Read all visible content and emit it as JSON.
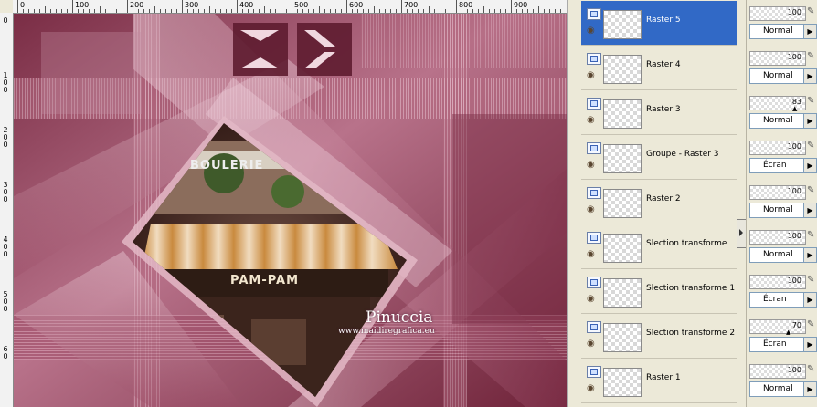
{
  "ruler": {
    "top_labels": [
      "0",
      "100",
      "200",
      "300",
      "400",
      "500",
      "600",
      "700",
      "800",
      "900"
    ],
    "left_labels": [
      "0",
      "1 0 0",
      "2 0 0",
      "3 0 0",
      "4 0 0",
      "5 0 0",
      "6 0"
    ]
  },
  "canvas": {
    "watermark_name": "Pinuccia",
    "watermark_url": "www.maidiregrafica.eu",
    "shop_sign": "PAM-PAM",
    "shop_sign_top": "BOULERIE"
  },
  "layers": [
    {
      "name": "Raster 5",
      "selected": true,
      "opacity": "100",
      "blend": "Normal"
    },
    {
      "name": "Raster 4",
      "selected": false,
      "opacity": "100",
      "blend": "Normal"
    },
    {
      "name": "Raster 3",
      "selected": false,
      "opacity": "83",
      "blend": "Normal"
    },
    {
      "name": "Groupe - Raster 3",
      "selected": false,
      "opacity": "100",
      "blend": "Écran"
    },
    {
      "name": "Raster 2",
      "selected": false,
      "opacity": "100",
      "blend": "Normal"
    },
    {
      "name": "Slection transforme",
      "selected": false,
      "opacity": "100",
      "blend": "Normal"
    },
    {
      "name": "Slection transforme 1",
      "selected": false,
      "opacity": "100",
      "blend": "Écran"
    },
    {
      "name": "Slection transforme 2",
      "selected": false,
      "opacity": "70",
      "blend": "Écran"
    },
    {
      "name": "Raster 1",
      "selected": false,
      "opacity": "100",
      "blend": "Normal"
    }
  ],
  "icons": {
    "visibility": "eye-icon",
    "layer_type": "raster-layer-icon",
    "edit": "pencil-icon",
    "dropdown": "arrow-right-icon"
  },
  "colors": {
    "selection": "#3169c6",
    "artwork_base": "#a0506a",
    "panel": "#ece9d8"
  }
}
